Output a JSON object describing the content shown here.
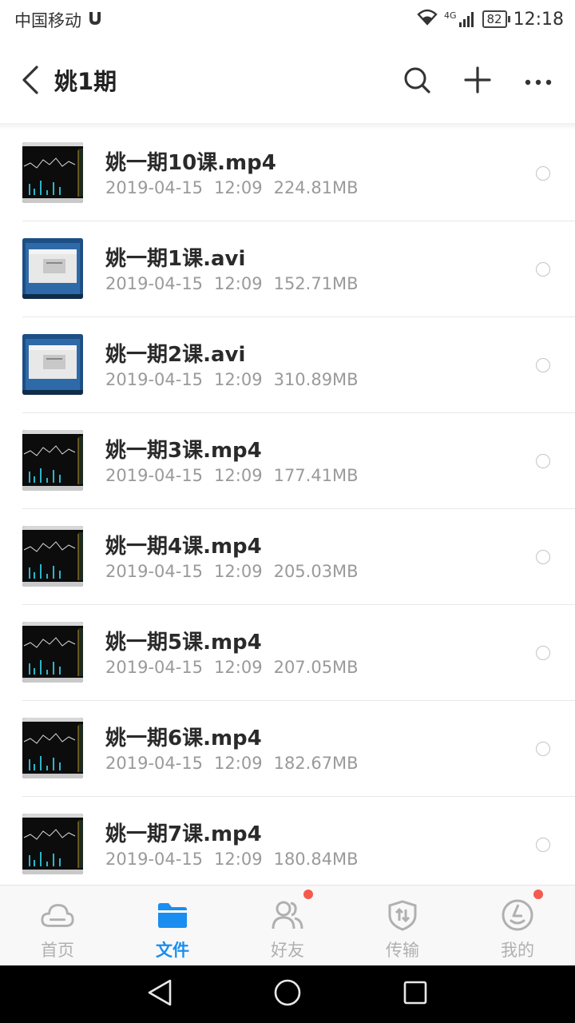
{
  "status_bar": {
    "carrier": "中国移动",
    "network": "4G",
    "battery": "82",
    "time": "12:18"
  },
  "header": {
    "title": "姚1期",
    "back_icon": "chevron-left-icon",
    "search_icon": "search-icon",
    "add_icon": "plus-icon",
    "more_icon": "more-icon"
  },
  "files": [
    {
      "name": "姚一期10课.mp4",
      "date": "2019-04-15",
      "time": "12:09",
      "size": "224.81MB",
      "thumb": "chart"
    },
    {
      "name": "姚一期1课.avi",
      "date": "2019-04-15",
      "time": "12:09",
      "size": "152.71MB",
      "thumb": "desktop"
    },
    {
      "name": "姚一期2课.avi",
      "date": "2019-04-15",
      "time": "12:09",
      "size": "310.89MB",
      "thumb": "desktop"
    },
    {
      "name": "姚一期3课.mp4",
      "date": "2019-04-15",
      "time": "12:09",
      "size": "177.41MB",
      "thumb": "chart"
    },
    {
      "name": "姚一期4课.mp4",
      "date": "2019-04-15",
      "time": "12:09",
      "size": "205.03MB",
      "thumb": "chart"
    },
    {
      "name": "姚一期5课.mp4",
      "date": "2019-04-15",
      "time": "12:09",
      "size": "207.05MB",
      "thumb": "chart"
    },
    {
      "name": "姚一期6课.mp4",
      "date": "2019-04-15",
      "time": "12:09",
      "size": "182.67MB",
      "thumb": "chart"
    },
    {
      "name": "姚一期7课.mp4",
      "date": "2019-04-15",
      "time": "12:09",
      "size": "180.84MB",
      "thumb": "chart"
    }
  ],
  "tabs": [
    {
      "label": "首页",
      "icon": "cloud-icon",
      "active": false,
      "badge": false
    },
    {
      "label": "文件",
      "icon": "folder-icon",
      "active": true,
      "badge": false
    },
    {
      "label": "好友",
      "icon": "friends-icon",
      "active": false,
      "badge": true
    },
    {
      "label": "传输",
      "icon": "transfer-icon",
      "active": false,
      "badge": false
    },
    {
      "label": "我的",
      "icon": "profile-icon",
      "active": false,
      "badge": true
    }
  ],
  "colors": {
    "accent": "#1a8ef0",
    "badge": "#f55a4e",
    "tab_inactive": "#b0b0b0"
  }
}
